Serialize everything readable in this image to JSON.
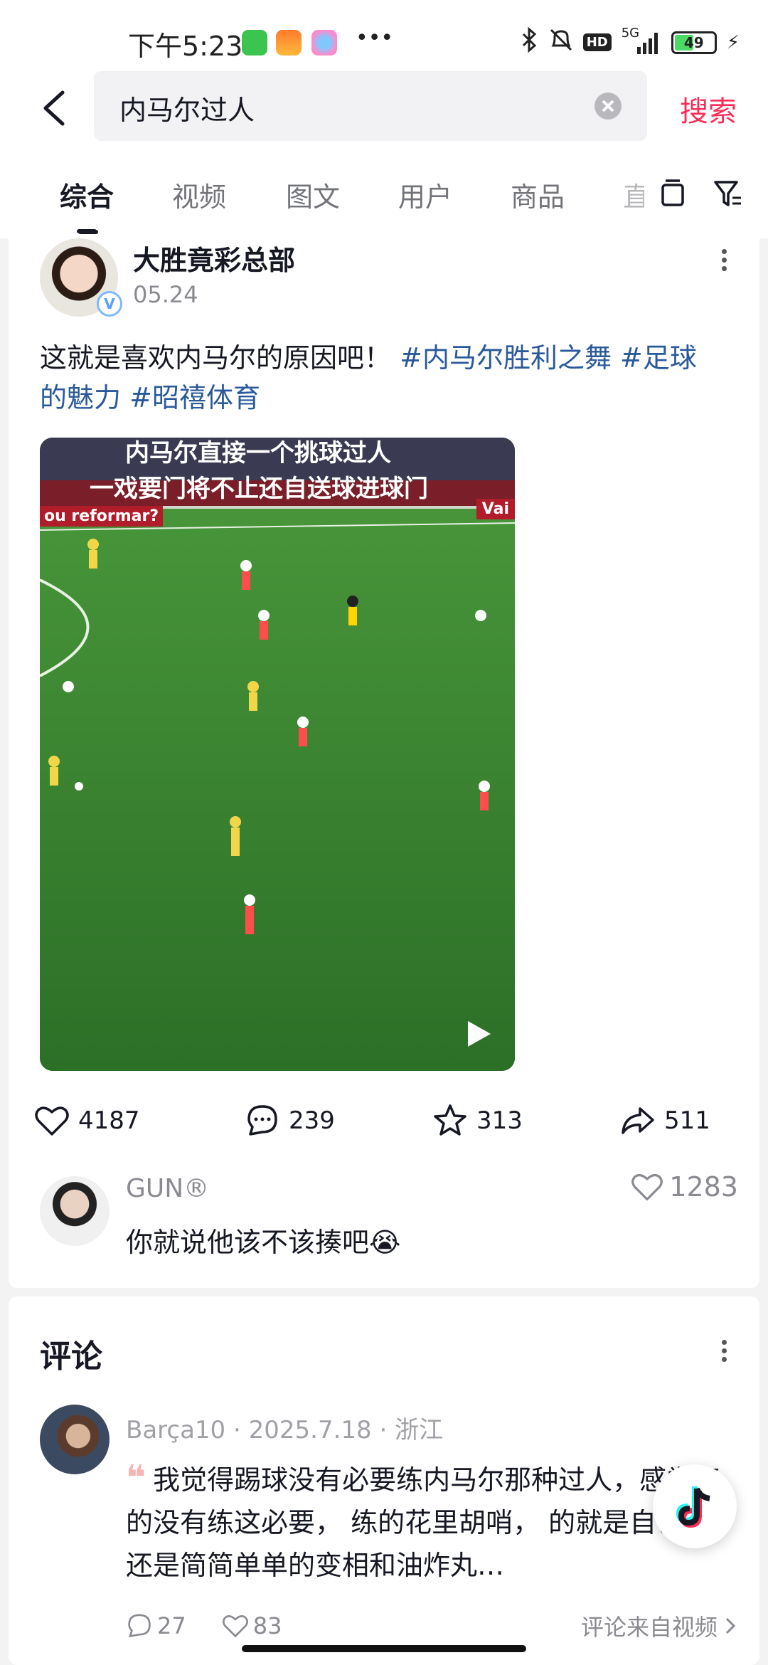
{
  "status_bar": {
    "time": "下午5:23",
    "network": "5G",
    "battery": "49"
  },
  "search": {
    "query": "内马尔过人",
    "submit_label": "搜索"
  },
  "tabs": [
    {
      "label": "综合",
      "active": true
    },
    {
      "label": "视频"
    },
    {
      "label": "图文"
    },
    {
      "label": "用户"
    },
    {
      "label": "商品"
    },
    {
      "label": "直"
    }
  ],
  "post": {
    "author": "大胜竟彩总部",
    "date": "05.24",
    "text": "这就是喜欢内马尔的原因吧！",
    "tags": [
      "#内马尔胜利之舞",
      "#足球的魅力",
      "#昭禧体育"
    ],
    "video_caption_1": "内马尔直接一个挑球过人",
    "video_caption_2": "一戏要门将不止还自送球进球门",
    "board_left": "ou reformar?",
    "board_right": "Vai",
    "stats": {
      "likes": "4187",
      "comments": "239",
      "favorites": "313",
      "shares": "511"
    }
  },
  "top_comment": {
    "user": "GUN®",
    "text": "你就说他该不该揍吧😭",
    "likes": "1283"
  },
  "comments_section": {
    "title": "评论",
    "comment": {
      "user": "Barça10",
      "date": "2025.7.18",
      "location": "浙江",
      "quote_mark": "❝",
      "text": "我觉得踢球没有必要练内马尔那种过人，感觉真的没有练这必要， 练的花里胡哨， 的就是自己， 还是简简单单的变相和油炸丸…",
      "replies": "27",
      "likes": "83",
      "source": "评论来自视频"
    }
  },
  "colors": {
    "accent": "#fe2c55",
    "tag": "#2a5a9a",
    "pitch": "#2f7b2a"
  }
}
